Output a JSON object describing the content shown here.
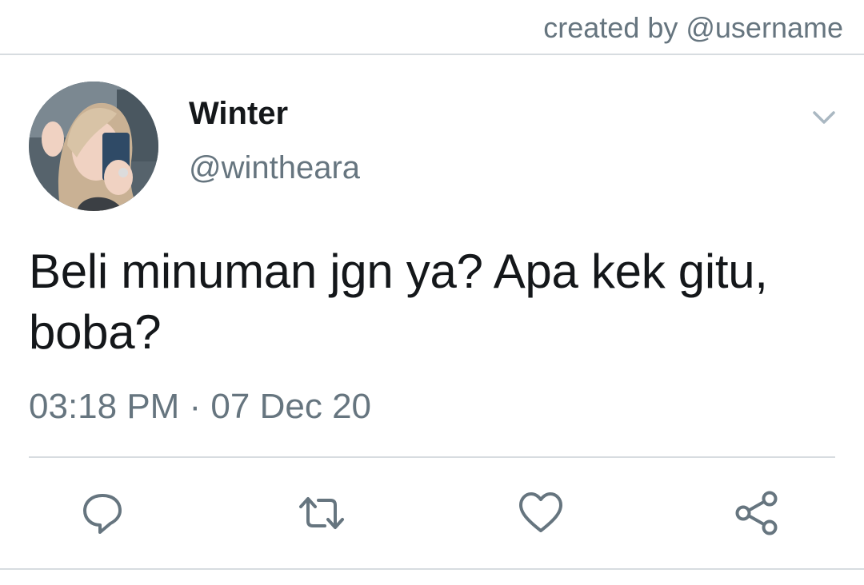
{
  "header": {
    "credit": "created by @username"
  },
  "tweet": {
    "author": {
      "display_name": "Winter",
      "handle": "@wintheara",
      "avatar": "avatar-photo"
    },
    "text": "Beli minuman jgn ya? Apa kek gitu, boba?",
    "timestamp": "03:18 PM · 07 Dec 20",
    "menu_icon": "chevron-down-icon"
  },
  "actions": [
    {
      "name": "reply",
      "icon": "reply-icon"
    },
    {
      "name": "retweet",
      "icon": "retweet-icon"
    },
    {
      "name": "like",
      "icon": "heart-icon"
    },
    {
      "name": "share",
      "icon": "share-icon"
    }
  ],
  "colors": {
    "text_primary": "#14171a",
    "text_secondary": "#66757f",
    "divider": "#d7dce0",
    "icon": "#66757f"
  }
}
